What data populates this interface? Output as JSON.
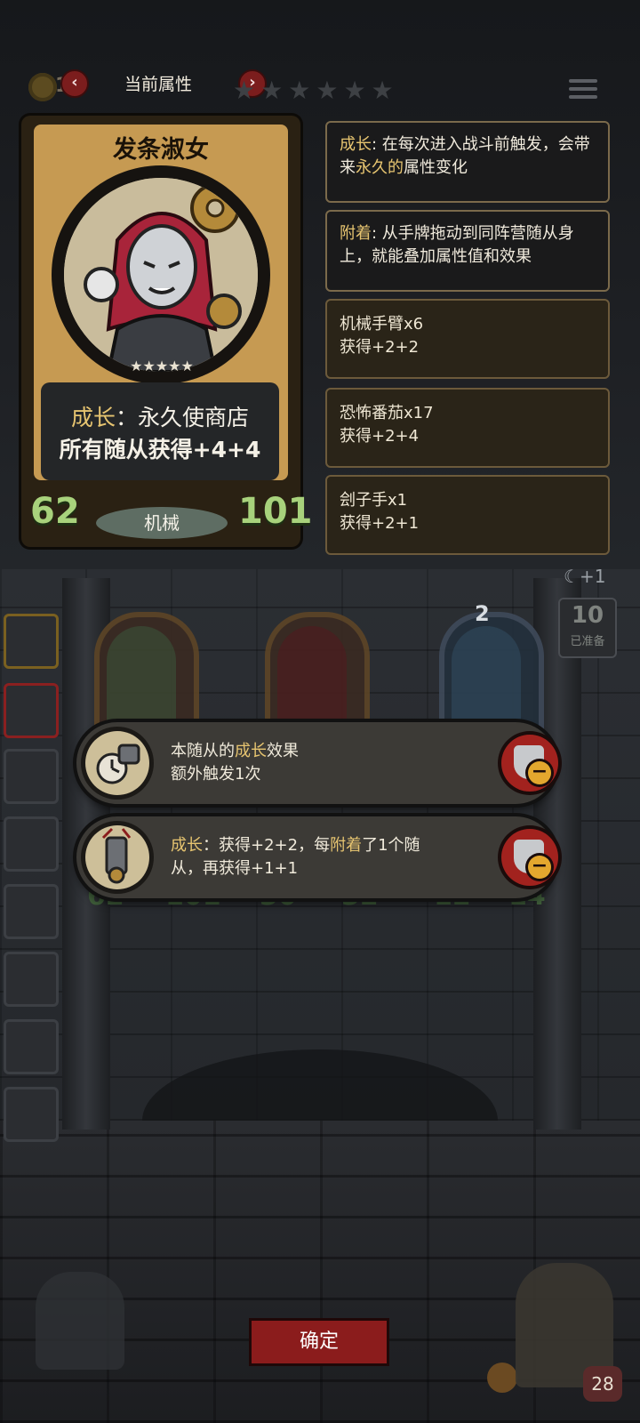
{
  "topbar": {
    "coins": "17",
    "title": "当前属性",
    "prev_icon": "‹",
    "next_icon": "›",
    "stars": [
      "★",
      "★",
      "★",
      "★",
      "★",
      "★"
    ]
  },
  "card": {
    "name": "发条淑女",
    "stars": "★★★★★",
    "desc_label": "成长",
    "desc_line1_rest": "：永久使商店",
    "desc_line2": "所有随从获得+4+4",
    "attack": "62",
    "health": "101",
    "tribe": "机械"
  },
  "info": {
    "growth_label": "成长",
    "growth_text_a": ": 在每次进入战斗前触发，会带来",
    "growth_highlight": "永久的",
    "growth_text_b": "属性变化",
    "attach_label": "附着",
    "attach_text": ": 从手牌拖动到同阵营随从身上，就能叠加属性值和效果"
  },
  "buff_rows": [
    {
      "name": "机械手臂x6",
      "gain": "获得+2+2"
    },
    {
      "name": "恐怖番茄x17",
      "gain": "获得+2+4"
    },
    {
      "name": "刽子手x1",
      "gain": "获得+2+1"
    }
  ],
  "battle": {
    "slot3_level": "2",
    "ready_count": "10",
    "ready_label": "已准备",
    "moon_bonus": "+1",
    "stats": [
      {
        "atk": "62",
        "hp": "101"
      },
      {
        "atk": "30",
        "hp": "32"
      },
      {
        "atk": "12",
        "hp": "14"
      }
    ]
  },
  "popups": [
    {
      "line1_a": "本随从的",
      "line1_hl": "成长",
      "line1_b": "效果",
      "line2": "额外触发1次"
    },
    {
      "line1_hl": "成长",
      "line1_a": "：获得+2+2，每",
      "line1_hl2": "附着",
      "line1_b": "了1个随",
      "line2": "从，再获得+1+1"
    }
  ],
  "bottom": {
    "confirm_label": "确定",
    "heart_value": "28"
  },
  "colors": {
    "accent_gold": "#e6c470",
    "stat_green": "#a8d27c",
    "button_red": "#8b1c1c"
  }
}
